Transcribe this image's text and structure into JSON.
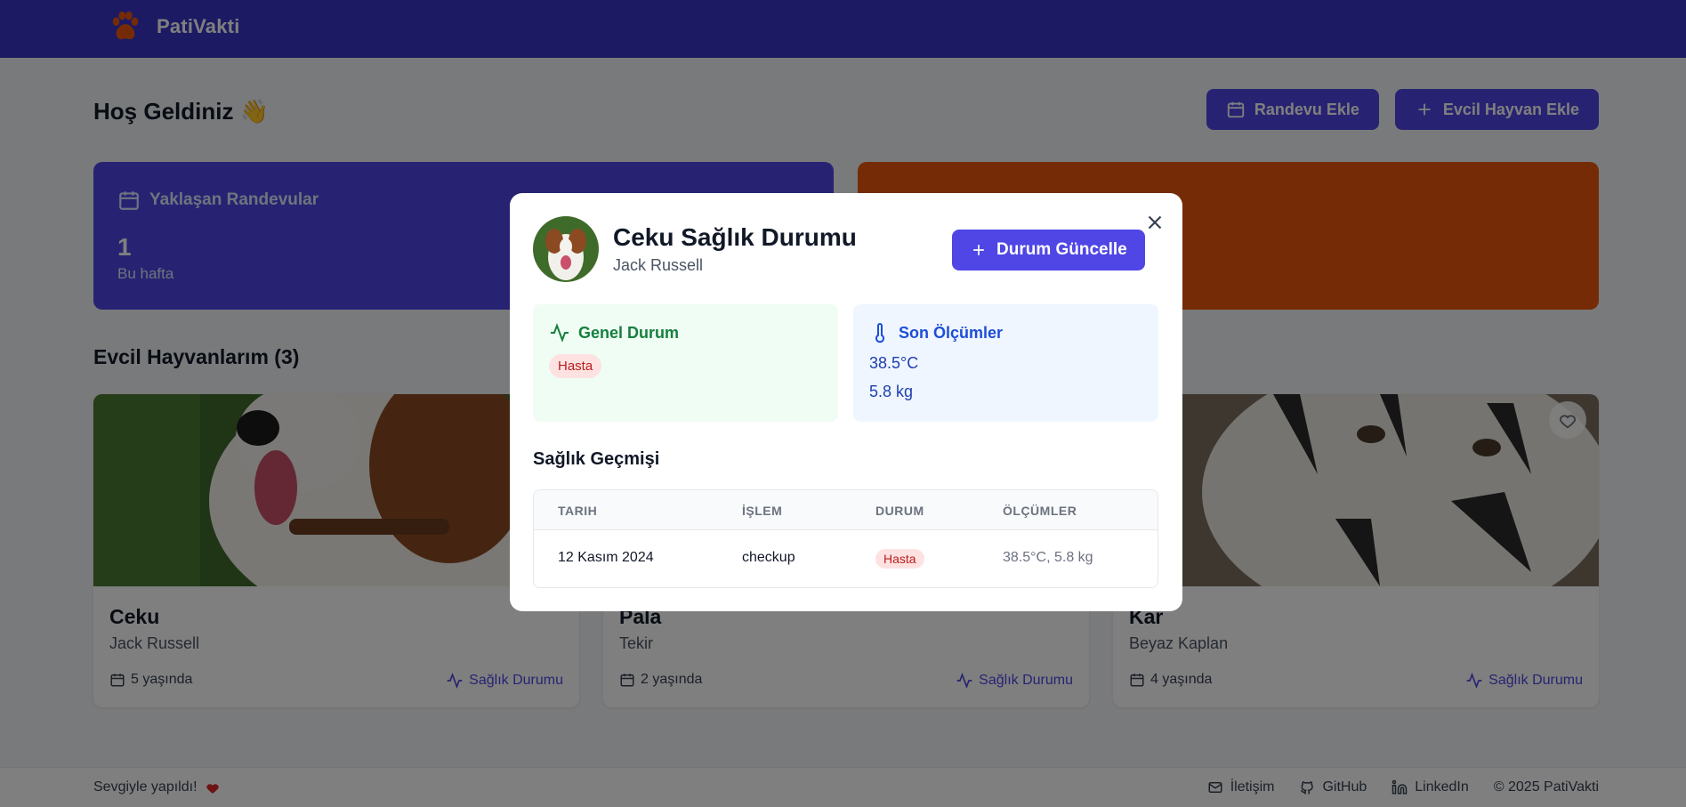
{
  "header": {
    "brand": "PatiVakti",
    "logo_icon": "paw-icon"
  },
  "main": {
    "welcome": "Hoş Geldiniz 👋",
    "actions": [
      {
        "label": "Randevu Ekle",
        "icon": "calendar-icon"
      },
      {
        "label": "Evcil Hayvan Ekle",
        "icon": "plus-icon"
      }
    ],
    "stats": {
      "appointments": {
        "title": "Yaklaşan Randevular",
        "value": "1",
        "sub": "Bu hafta"
      }
    },
    "pets_title": "Evcil Hayvanlarım (3)",
    "pets": [
      {
        "name": "Ceku",
        "breed": "Jack Russell",
        "age": "5 yaşında",
        "health": "Sağlık Durumu"
      },
      {
        "name": "Pala",
        "breed": "Tekir",
        "age": "2 yaşında",
        "health": "Sağlık Durumu"
      },
      {
        "name": "Kar",
        "breed": "Beyaz Kaplan",
        "age": "4 yaşında",
        "health": "Sağlık Durumu"
      }
    ]
  },
  "footer": {
    "left": "Sevgiyle yapıldı!",
    "links": [
      "İletişim",
      "GitHub",
      "LinkedIn"
    ],
    "copyright": "© 2025 PatiVakti"
  },
  "modal": {
    "title": "Ceku Sağlık Durumu",
    "subtitle": "Jack Russell",
    "update_label": "Durum Güncelle",
    "general": {
      "title": "Genel Durum",
      "status": "Hasta"
    },
    "measurements": {
      "title": "Son Ölçümler",
      "temperature": "38.5°C",
      "weight": "5.8 kg"
    },
    "history": {
      "title": "Sağlık Geçmişi",
      "columns": [
        "TARIH",
        "İŞLEM",
        "DURUM",
        "ÖLÇÜMLER"
      ],
      "rows": [
        {
          "date": "12 Kasım 2024",
          "procedure": "checkup",
          "status": "Hasta",
          "measurements": "38.5°C, 5.8 kg"
        }
      ]
    }
  },
  "colors": {
    "primary": "#4f46e5",
    "header": "#3b34c9",
    "orange": "#ea580c",
    "danger": "#dc2626"
  }
}
